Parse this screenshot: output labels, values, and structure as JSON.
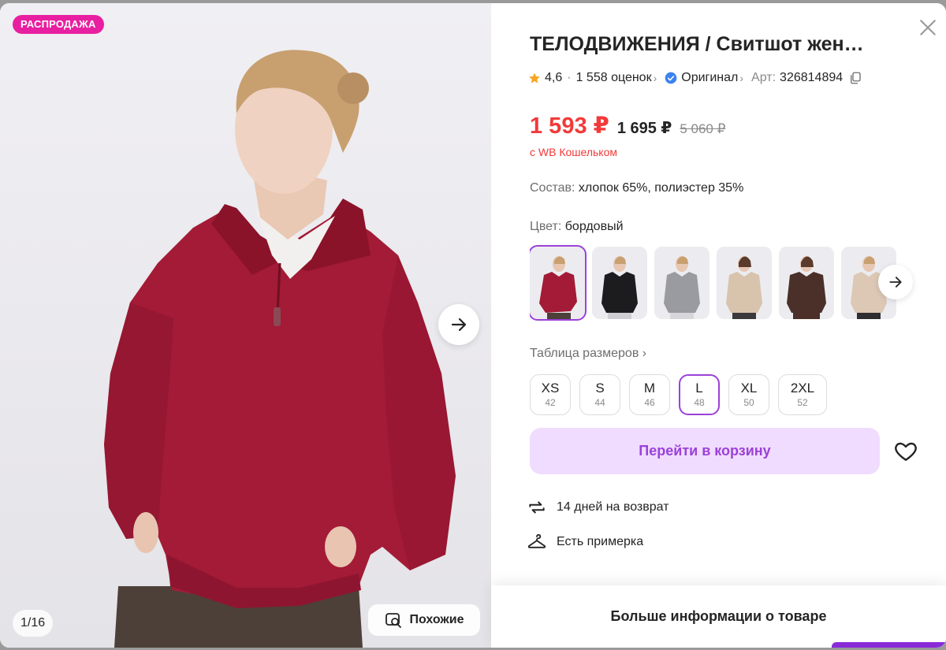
{
  "gallery": {
    "badge": "РАСПРОДАЖА",
    "counter": "1/16",
    "similar_label": "Похожие",
    "sweater_color": "#a31b36"
  },
  "product": {
    "title": "ТЕЛОДВИЖЕНИЯ / Свитшот жен…",
    "rating": "4,6",
    "reviews": "1 558 оценок",
    "original_label": "Оригинал",
    "article_label": "Арт:",
    "article_value": "326814894",
    "price_main": "1 593 ₽",
    "price_regular": "1 695 ₽",
    "price_old": "5 060 ₽",
    "wallet_note": "с WB Кошельком",
    "composition_label": "Состав:",
    "composition_value": "хлопок 65%, полиэстер 35%",
    "color_label": "Цвет:",
    "color_value": "бордовый",
    "swatches": [
      {
        "name": "бордовый",
        "color": "#a31b36",
        "active": true
      },
      {
        "name": "черный",
        "color": "#1c1c1e",
        "active": false
      },
      {
        "name": "серый",
        "color": "#9a9ba0",
        "active": false
      },
      {
        "name": "бежевый",
        "color": "#d8c3ad",
        "active": false
      },
      {
        "name": "коричневый",
        "color": "#4a3029",
        "active": false
      },
      {
        "name": "светло-бежевый",
        "color": "#dcc8b5",
        "active": false
      }
    ],
    "size_table_label": "Таблица размеров",
    "sizes": [
      {
        "label": "XS",
        "ru": "42",
        "active": false
      },
      {
        "label": "S",
        "ru": "44",
        "active": false
      },
      {
        "label": "M",
        "ru": "46",
        "active": false
      },
      {
        "label": "L",
        "ru": "48",
        "active": true
      },
      {
        "label": "XL",
        "ru": "50",
        "active": false
      },
      {
        "label": "2XL",
        "ru": "52",
        "active": false
      }
    ],
    "cart_button": "Перейти в корзину",
    "return_info": "14 дней на возврат",
    "fitting_info": "Есть примерка",
    "more_info": "Больше информации о товаре"
  },
  "colors": {
    "accent": "#9b41d8",
    "price_red": "#f23a3a",
    "badge_pink": "#e81fa0",
    "cart_bg": "#f0dcff",
    "star": "#f5a623",
    "verified": "#3c82f0"
  }
}
